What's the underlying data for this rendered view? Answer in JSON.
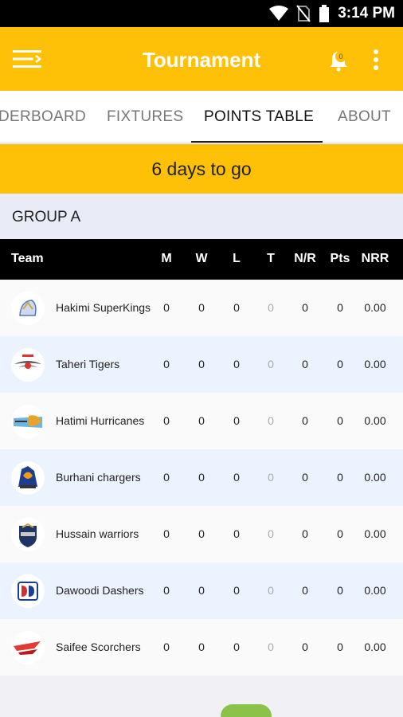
{
  "status_bar": {
    "time": "3:14 PM",
    "icons": [
      "wifi-icon",
      "no-sim-icon",
      "battery-icon"
    ]
  },
  "app_bar": {
    "title": "Tournament",
    "notification_count": "0",
    "icons": [
      "hamburger-menu-icon",
      "bell-icon",
      "more-vert-icon"
    ]
  },
  "tabs": [
    {
      "label": "LEADERBOARD",
      "display": "DERBOARD",
      "active": false
    },
    {
      "label": "FIXTURES",
      "active": false
    },
    {
      "label": "POINTS TABLE",
      "active": true
    },
    {
      "label": "ABOUT",
      "active": false
    }
  ],
  "countdown": "6 days to go",
  "group": {
    "title": "GROUP A"
  },
  "table": {
    "columns": [
      "Team",
      "M",
      "W",
      "L",
      "T",
      "N/R",
      "Pts",
      "NRR"
    ],
    "rows": [
      {
        "team": "Hakimi SuperKings",
        "M": "0",
        "W": "0",
        "L": "0",
        "T": "0",
        "NR": "0",
        "Pts": "0",
        "NRR": "0.00"
      },
      {
        "team": "Taheri Tigers",
        "M": "0",
        "W": "0",
        "L": "0",
        "T": "0",
        "NR": "0",
        "Pts": "0",
        "NRR": "0.00"
      },
      {
        "team": "Hatimi Hurricanes",
        "M": "0",
        "W": "0",
        "L": "0",
        "T": "0",
        "NR": "0",
        "Pts": "0",
        "NRR": "0.00"
      },
      {
        "team": "Burhani chargers",
        "M": "0",
        "W": "0",
        "L": "0",
        "T": "0",
        "NR": "0",
        "Pts": "0",
        "NRR": "0.00"
      },
      {
        "team": "Hussain warriors",
        "M": "0",
        "W": "0",
        "L": "0",
        "T": "0",
        "NR": "0",
        "Pts": "0",
        "NRR": "0.00"
      },
      {
        "team": "Dawoodi Dashers",
        "M": "0",
        "W": "0",
        "L": "0",
        "T": "0",
        "NR": "0",
        "Pts": "0",
        "NRR": "0.00"
      },
      {
        "team": "Saifee Scorchers",
        "M": "0",
        "W": "0",
        "L": "0",
        "T": "0",
        "NR": "0",
        "Pts": "0",
        "NRR": "0.00"
      }
    ]
  },
  "colors": {
    "accent": "#ffc107",
    "header_bg": "#000000",
    "row_alt": "#eaf3fe",
    "group_bg": "#e9ebf6"
  }
}
